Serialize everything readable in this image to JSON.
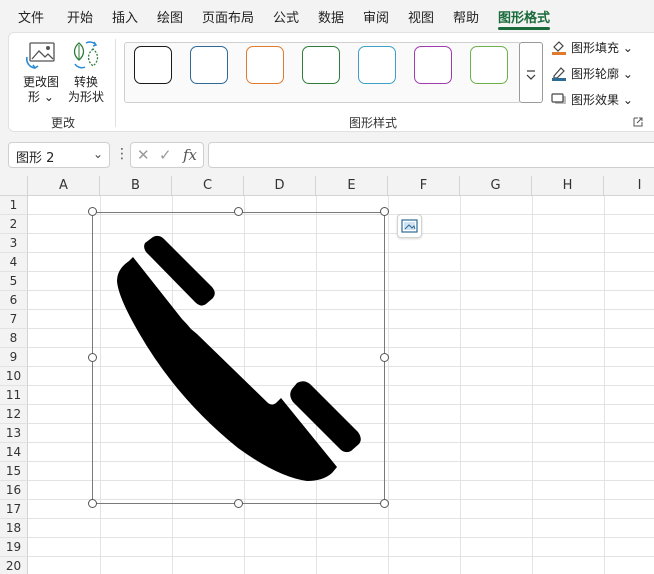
{
  "menu": {
    "tabs": [
      {
        "label": "文件"
      },
      {
        "label": "开始"
      },
      {
        "label": "插入"
      },
      {
        "label": "绘图"
      },
      {
        "label": "页面布局"
      },
      {
        "label": "公式"
      },
      {
        "label": "数据"
      },
      {
        "label": "审阅"
      },
      {
        "label": "视图"
      },
      {
        "label": "帮助"
      },
      {
        "label": "图形格式"
      }
    ],
    "active_tab": "图形格式",
    "accent_color": "#1a6b3c"
  },
  "ribbon": {
    "change_group": {
      "change_graphic_line1": "更改图",
      "change_graphic_line2": "形",
      "convert_line1": "转换",
      "convert_line2": "为形状",
      "label": "更改"
    },
    "styles_group": {
      "label": "图形样式",
      "swatch_colors": [
        "#1a1a1a",
        "#2e6a96",
        "#e07a2e",
        "#2f7d3a",
        "#3ea0c4",
        "#a03cb0",
        "#6bb24a"
      ]
    },
    "format": {
      "fill": "图形填充",
      "outline": "图形轮廓",
      "effects": "图形效果"
    }
  },
  "formula_bar": {
    "name_box": "图形 2",
    "fx": "fx",
    "formula": ""
  },
  "sheet": {
    "columns": [
      "A",
      "B",
      "C",
      "D",
      "E",
      "F",
      "G",
      "H",
      "I"
    ],
    "rows": [
      "1",
      "2",
      "3",
      "4",
      "5",
      "6",
      "7",
      "8",
      "9",
      "10",
      "11",
      "12",
      "13",
      "14",
      "15",
      "16",
      "17",
      "18",
      "19",
      "20"
    ]
  },
  "shape": {
    "icon": "phone-handset-icon",
    "fill_color": "#000000"
  }
}
